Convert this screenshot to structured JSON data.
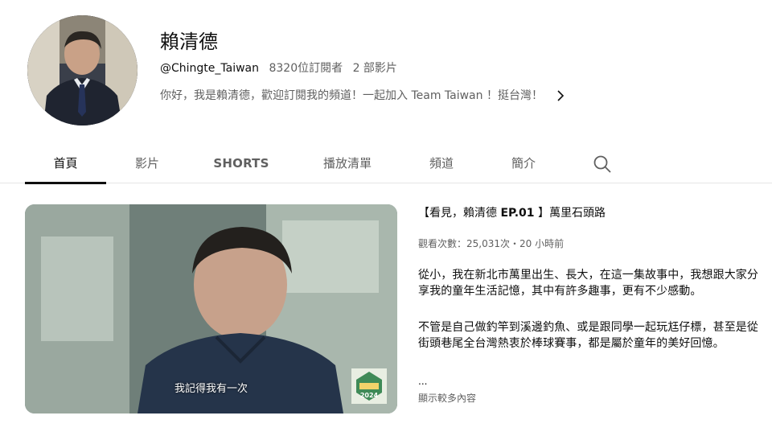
{
  "channel": {
    "name": "賴清德",
    "handle": "@Chingte_Taiwan",
    "subscribers": "8320位訂閱者",
    "videos": "2 部影片",
    "description": "你好，我是賴清德，歡迎訂閱我的頻道！一起加入 Team Taiwan ！挺台灣！",
    "more_icon": "chevron-right-icon"
  },
  "tabs": [
    {
      "label": "首頁",
      "active": true
    },
    {
      "label": "影片",
      "active": false
    },
    {
      "label": "SHORTS",
      "active": false
    },
    {
      "label": "播放清單",
      "active": false
    },
    {
      "label": "頻道",
      "active": false
    },
    {
      "label": "簡介",
      "active": false
    }
  ],
  "search_icon": "search-icon",
  "featured": {
    "title_open": "【看見，賴清德 ",
    "title_ep": "EP.01",
    "title_close": " 】萬里石頭路",
    "views": "觀看次數：25,031次・20 小時前",
    "paragraph1": "從小，我在新北市萬里出生、長大，在這一集故事中，我想跟大家分享我的童年生活記憶，其中有許多趣事，更有不少感動。",
    "paragraph2": "不管是自己做釣竿到溪邊釣魚、或是跟同學一起玩尪仔標，甚至是從街頭巷尾全台灣熱衷於棒球賽事，都是屬於童年的美好回憶。",
    "ellipsis": "...",
    "show_more": "顯示較多內容",
    "subtitle": "我記得我有一次",
    "logo_text": "2024"
  },
  "colors": {
    "text_primary": "#0f0f0f",
    "text_secondary": "#606060",
    "divider": "#e5e5e5"
  }
}
